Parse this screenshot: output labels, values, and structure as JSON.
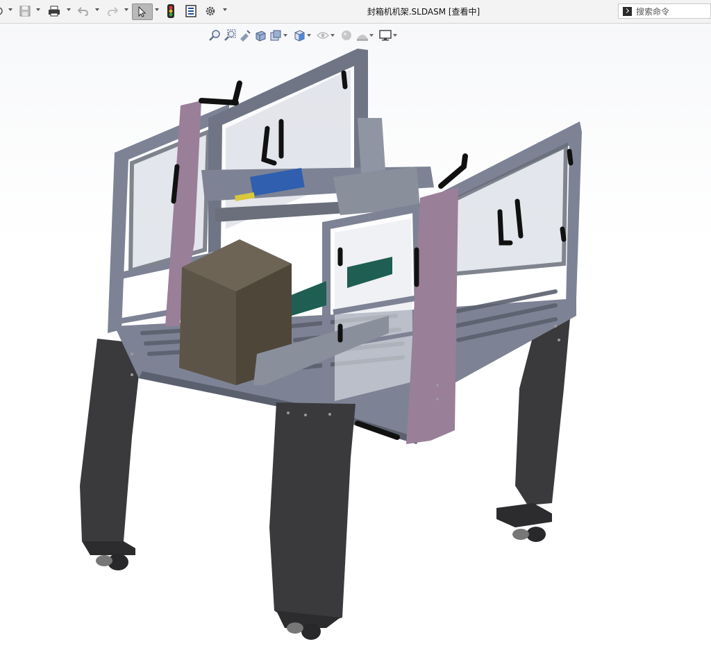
{
  "window": {
    "title": "封箱机机架.SLDASM [查看中]"
  },
  "toolbar": {
    "buttons": [
      "open-icon",
      "save-icon",
      "print-icon",
      "undo-icon",
      "redo-icon",
      "select-icon",
      "rebuild-icon",
      "file-properties-icon",
      "options-icon"
    ]
  },
  "search": {
    "placeholder": "搜索命令"
  },
  "headsup_toolbar": {
    "tools": [
      "zoom-to-fit-icon",
      "zoom-to-area-icon",
      "previous-view-icon",
      "section-view-icon",
      "dynamic-annotation-icon",
      "view-orientation-icon",
      "display-style-icon",
      "hide-show-items-icon",
      "edit-appearance-icon",
      "apply-scene-icon",
      "view-settings-icon"
    ]
  },
  "model": {
    "name": "封箱机机架",
    "colors": {
      "frame": "#7d8394",
      "frame_dark": "#5b606e",
      "legs": "#3a3a3d",
      "side_panel": "#9a7f99",
      "box": "#5d5448",
      "handle": "#111111",
      "cylinder_blue": "#2f5fae",
      "rod_yellow": "#d8c83a",
      "belt_green": "#1f5e52"
    }
  }
}
